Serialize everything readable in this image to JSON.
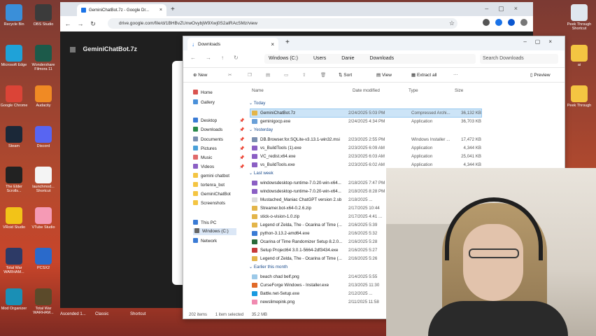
{
  "desktop": {
    "icons_left": [
      {
        "label": "Recycle Bin",
        "color": "#3a8fd9"
      },
      {
        "label": "OBS Studio",
        "color": "#3b3b3b"
      },
      {
        "label": "Microsoft Edge",
        "color": "#1fa2d8"
      },
      {
        "label": "Wondershare Filmora 11",
        "color": "#1c5a4a"
      },
      {
        "label": "Google Chrome",
        "color": "#db4437"
      },
      {
        "label": "Audacity",
        "color": "#f08a24"
      },
      {
        "label": "Steam",
        "color": "#1b2838"
      },
      {
        "label": "Discord",
        "color": "#5865f2"
      },
      {
        "label": "The Elder Scrolls...",
        "color": "#222222"
      },
      {
        "label": "launchmod... Shortcut",
        "color": "#f4f4f4"
      },
      {
        "label": "VRoid Studio",
        "color": "#f2c318"
      },
      {
        "label": "VTube Studio",
        "color": "#f59ab5"
      },
      {
        "label": "Total War WARHAM...",
        "color": "#2d3a66"
      },
      {
        "label": "PCSX2",
        "color": "#2a6acb"
      },
      {
        "label": "Mod Organizer",
        "color": "#1a8fb5"
      },
      {
        "label": "Total War WARHAM...",
        "color": "#5b4a2a"
      }
    ],
    "icons_right": [
      {
        "label": "Peek Through Shortcut",
        "color": "#dfe7ef"
      },
      {
        "label": "ai",
        "color": "#f4c542"
      },
      {
        "label": "Peek Through",
        "color": "#f4c542"
      }
    ],
    "taskbar_labels": [
      "Ascended 1...",
      "Classic",
      "Shortcut"
    ]
  },
  "chrome": {
    "tab_title": "GeminiChatBot.7z - Google Dr...",
    "url": "drive.google.com/file/d/1BHBvZUnwOvybjW9Xwj0S2aIRAcSMz/view",
    "drive_file_title": "GeminiChatBot.7z"
  },
  "explorer": {
    "tab_title": "Downloads",
    "breadcrumb": [
      "Windows (C:)",
      "Users",
      "Danie",
      "Downloads"
    ],
    "search_placeholder": "Search Downloads",
    "commands": {
      "new": "New",
      "sort": "Sort",
      "view": "View",
      "extract": "Extract all",
      "more": "···",
      "preview": "Preview"
    },
    "columns": {
      "name": "Name",
      "date": "Date modified",
      "type": "Type",
      "size": "Size"
    },
    "nav": {
      "home": "Home",
      "gallery": "Gallery",
      "desktop": "Desktop",
      "downloads": "Downloads",
      "documents": "Documents",
      "pictures": "Pictures",
      "music": "Music",
      "videos": "Videos",
      "gemini": "gemini chatbot",
      "tortenra": "tortenra_bot",
      "geminichatbot": "GeminiChatBot",
      "screenshots": "Screenshots",
      "thispc": "This PC",
      "windows": "Windows (C:)",
      "network": "Network"
    },
    "groups": {
      "today": "Today",
      "yesterday": "Yesterday",
      "lastweek": "Last week",
      "earlier": "Earlier this month"
    },
    "files_today": [
      {
        "name": "GeminiChatBot.7z",
        "date": "2/24/2025 5:03 PM",
        "type": "Compressed Archi...",
        "size": "36,132 KB",
        "color": "#e3b54a"
      },
      {
        "name": "geminigocp.exe",
        "date": "2/24/2025 4:34 PM",
        "type": "Application",
        "size": "36,703 KB",
        "color": "#6aa0d8"
      }
    ],
    "files_yesterday": [
      {
        "name": "DB.Browser.for.SQLite-v3.13.1-win32.msi",
        "date": "2/23/2025 2:55 PM",
        "type": "Windows Installer ...",
        "size": "17,472 KB",
        "color": "#7a8fb0"
      },
      {
        "name": "vs_BuildTools (1).exe",
        "date": "2/23/2025 6:09 AM",
        "type": "Application",
        "size": "4,344 KB",
        "color": "#8b5fc4"
      },
      {
        "name": "VC_redist.x64.exe",
        "date": "2/23/2025 6:03 AM",
        "type": "Application",
        "size": "25,041 KB",
        "color": "#8b5fc4"
      },
      {
        "name": "vs_BuildTools.exe",
        "date": "2/23/2025 6:02 AM",
        "type": "Application",
        "size": "4,344 KB",
        "color": "#8b5fc4"
      }
    ],
    "files_lastweek": [
      {
        "name": "windowsdesktop-runtime-7.0.20-win-x64...",
        "date": "2/18/2025 7:47 PM",
        "type": "",
        "size": "",
        "color": "#8b5fc4"
      },
      {
        "name": "windowsdesktop-runtime-7.0.20-win-x64...",
        "date": "2/18/2025 8:28 PM",
        "type": "",
        "size": "",
        "color": "#8b5fc4"
      },
      {
        "name": "Mustached_Maniac ChatGPT version 2.sb",
        "date": "2/18/2025 ...",
        "type": "",
        "size": "",
        "color": "#dcdcdc"
      },
      {
        "name": "Streamer.bot-x64-0.2.6.zip",
        "date": "2/17/2025 10:44",
        "type": "",
        "size": "",
        "color": "#e3b54a"
      },
      {
        "name": "stick-o-vision-1.0.zip",
        "date": "2/17/2025 4:41 ...",
        "type": "",
        "size": "",
        "color": "#e3b54a"
      },
      {
        "name": "Legend of Zelda, The - Ocarina of Time (...",
        "date": "2/16/2025 5:39",
        "type": "",
        "size": "",
        "color": "#e3b54a"
      },
      {
        "name": "python-3.13.2-amd64.exe",
        "date": "2/16/2025 5:32",
        "type": "",
        "size": "",
        "color": "#3a7bd5"
      },
      {
        "name": "Ocarina of Time Randomizer Setup 8.2.0...",
        "date": "2/16/2025 5:28",
        "type": "",
        "size": "",
        "color": "#2a6a3a"
      },
      {
        "name": "Setup Project64 3.0.1-5664-2df3434.exe",
        "date": "2/16/2025 5:27",
        "type": "",
        "size": "",
        "color": "#c73a3a"
      },
      {
        "name": "Legend of Zelda, The - Ocarina of Time (...",
        "date": "2/16/2025 5:26",
        "type": "",
        "size": "",
        "color": "#e3b54a"
      }
    ],
    "files_earlier": [
      {
        "name": "beach chad belf.png",
        "date": "2/14/2025 5:55",
        "type": "",
        "size": "",
        "color": "#9cc9e8"
      },
      {
        "name": "CurseForge Windows - Installer.exe",
        "date": "2/13/2025 11:30",
        "type": "",
        "size": "",
        "color": "#e06a2a"
      },
      {
        "name": "Battle.net-Setup.exe",
        "date": "2/12/2025 ...",
        "type": "",
        "size": "",
        "color": "#1a9ae0"
      },
      {
        "name": "newslimepink.png",
        "date": "2/11/2025 11:58",
        "type": "",
        "size": "",
        "color": "#f08ab0"
      }
    ],
    "status": {
      "items": "202 items",
      "selected": "1 item selected",
      "size": "35.2 MB"
    }
  }
}
